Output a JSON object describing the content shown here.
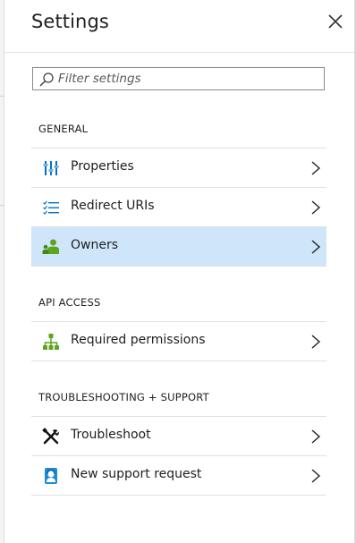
{
  "header": {
    "title": "Settings"
  },
  "filter": {
    "placeholder": "Filter settings",
    "value": ""
  },
  "sections": [
    {
      "title": "GENERAL",
      "items": [
        {
          "label": "Properties",
          "icon": "properties-icon"
        },
        {
          "label": "Redirect URIs",
          "icon": "list-icon"
        },
        {
          "label": "Owners",
          "icon": "owners-icon",
          "selected": true,
          "highlighted": true
        }
      ]
    },
    {
      "title": "API ACCESS",
      "items": [
        {
          "label": "Required permissions",
          "icon": "permissions-icon"
        }
      ]
    },
    {
      "title": "TROUBLESHOOTING + SUPPORT",
      "items": [
        {
          "label": "Troubleshoot",
          "icon": "tools-icon"
        },
        {
          "label": "New support request",
          "icon": "support-icon"
        }
      ]
    }
  ],
  "colors": {
    "accent_blue": "#0072c6",
    "selected_row": "#cfe6fa",
    "highlight": "#e2f900",
    "green": "#5ca61f"
  }
}
